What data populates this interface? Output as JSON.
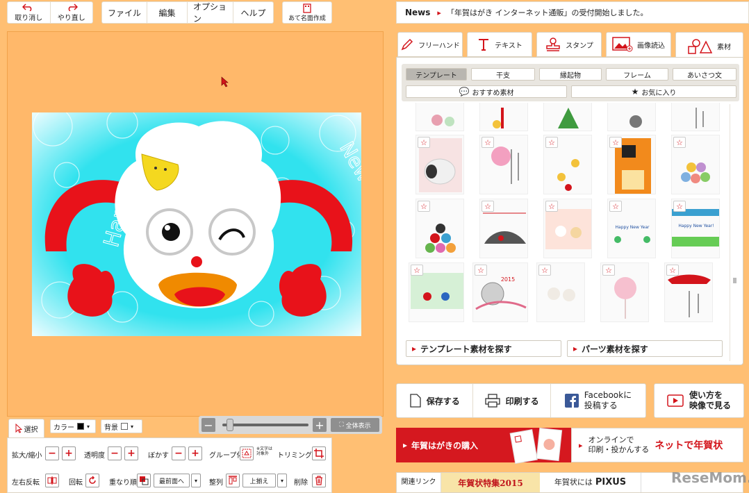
{
  "toolbar": {
    "undo_label": "取り消し",
    "redo_label": "やり直し",
    "menu": [
      "ファイル",
      "編集",
      "オプション",
      "ヘルプ"
    ],
    "address_label": "あて名面作成"
  },
  "news": {
    "label": "News",
    "text": "「年賀はがき インターネット通販」の受付開始しました。"
  },
  "tool_tabs": [
    "フリーハンド",
    "テキスト",
    "スタンプ",
    "画像読込",
    "素材"
  ],
  "categories": [
    "テンプレート",
    "干支",
    "縁起物",
    "フレーム",
    "あいさつ文"
  ],
  "sub_categories": [
    "おすすめ素材",
    "お気に入り"
  ],
  "search_buttons": [
    "テンプレート素材を探す",
    "パーツ素材を探す"
  ],
  "actions": {
    "save": "保存する",
    "print": "印刷する",
    "facebook_line1": "Facebookに",
    "facebook_line2": "投稿する",
    "video_line1": "使い方を",
    "video_line2": "映像で見る"
  },
  "purchase": {
    "left": "年賀はがきの購入",
    "right_line1": "オンラインで",
    "right_line2": "印刷・投かんする",
    "right_brand": "ネットで年賀状"
  },
  "footer": {
    "related": "関連リンク",
    "feature": "年賀状特集2015",
    "pixus_prefix": "年賀状には",
    "pixus": "PIXUS",
    "watermark": "ReseMom."
  },
  "bottom_tools": {
    "select": "選択",
    "color": "カラー",
    "background": "背景",
    "fit": "全体表示",
    "scale": "拡大/縮小",
    "opacity": "透明度",
    "blur": "ぼかす",
    "group": "グループ化",
    "group_note1": "※文字は",
    "group_note2": "対象外",
    "trim": "トリミング",
    "flip": "左右反転",
    "rotate": "回転",
    "order": "重なり順",
    "order_value": "最前面へ",
    "align": "整列",
    "align_value": "上揃え",
    "delete": "削除"
  },
  "card": {
    "arc_left": "Happy",
    "arc_right": "New Year!"
  },
  "thumb_texts": {
    "year": "2015",
    "hny": "Happy New Year",
    "hny2": "Happy New Year!"
  },
  "colors": {
    "accent": "#d3141b",
    "card_bg": "#31e2ee",
    "page_bg": "#ffbf73"
  }
}
